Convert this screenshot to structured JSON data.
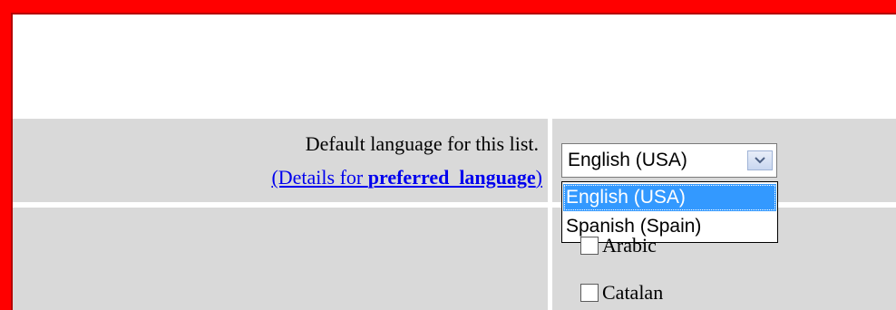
{
  "form": {
    "default_language_label": "Default language for this list.",
    "details_link_prefix": "(Details for ",
    "details_link_bold": "preferred  language",
    "details_link_suffix": ")",
    "language_select": {
      "selected": "English (USA)",
      "options": [
        "English (USA)",
        "Spanish (Spain)"
      ]
    },
    "languages": [
      {
        "label": "Arabic",
        "checked": false
      },
      {
        "label": "Catalan",
        "checked": false
      }
    ]
  },
  "colors": {
    "frame": "#ff0000",
    "row_background": "#d9d9d9",
    "link": "#0000ee",
    "highlight": "#3399ff"
  },
  "icons": {
    "dropdown": "chevron-down-icon"
  }
}
